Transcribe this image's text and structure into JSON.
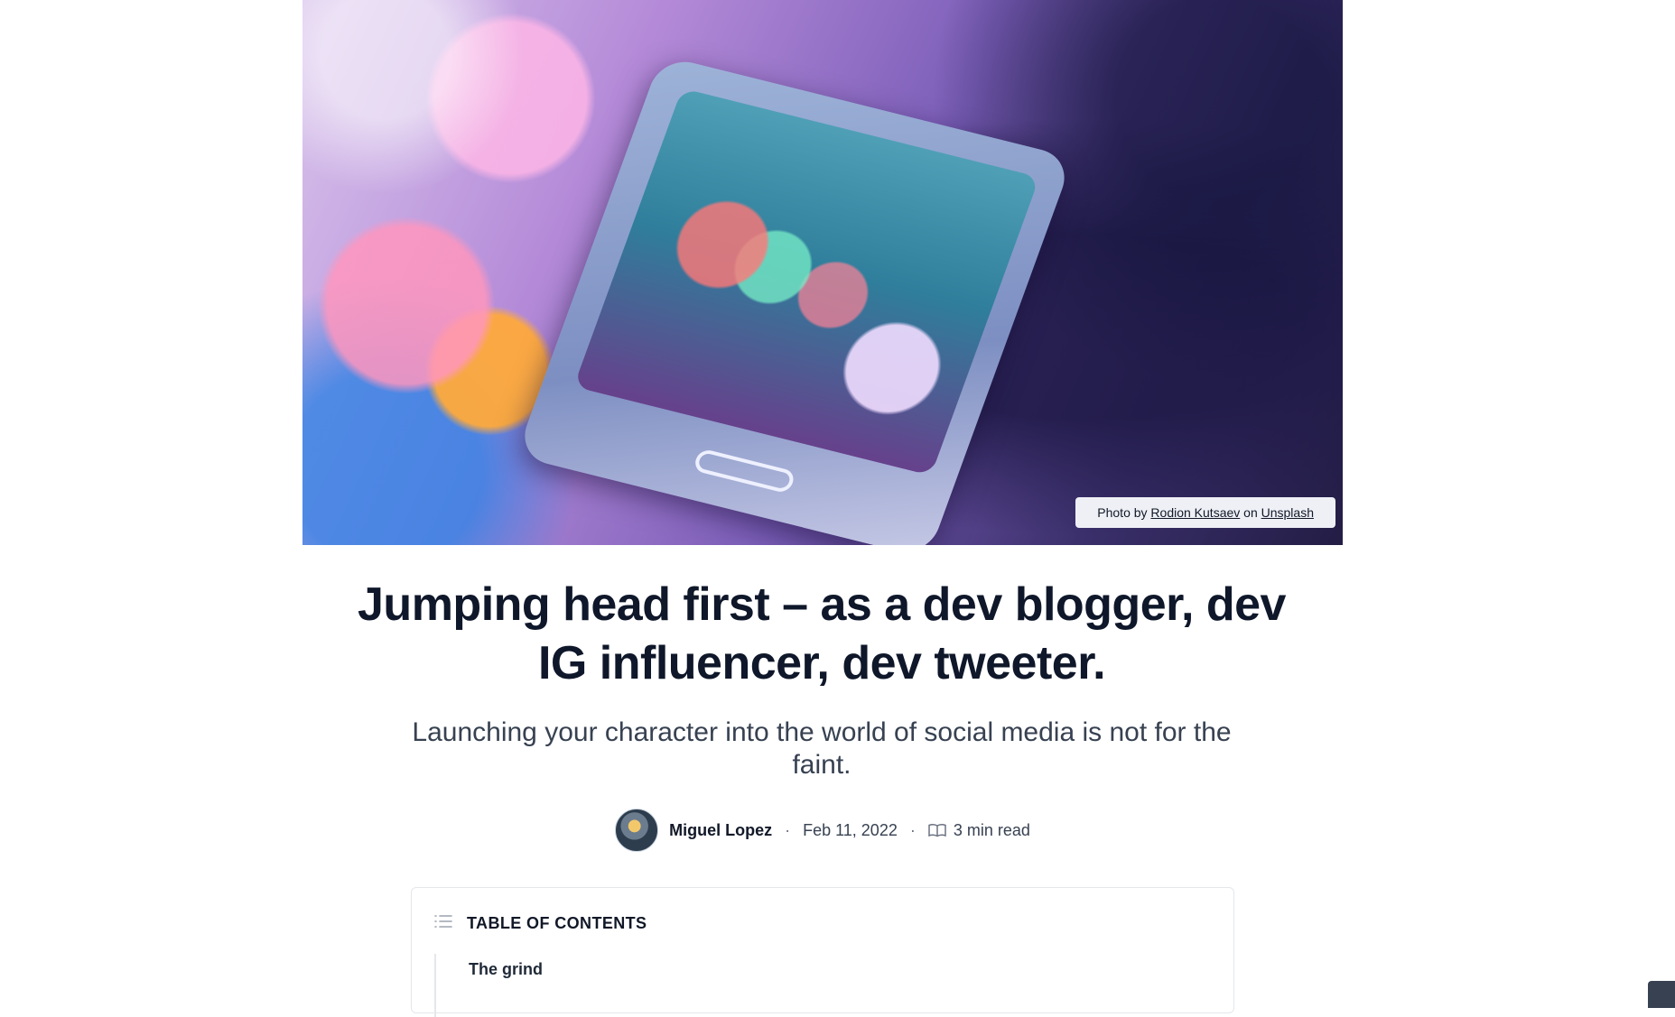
{
  "hero": {
    "caption_prefix": "Photo by",
    "caption_author": "Rodion Kutsaev",
    "caption_middle": "on",
    "caption_source": "Unsplash"
  },
  "article": {
    "title": "Jumping head first – as a dev blogger, dev IG influencer, dev tweeter.",
    "subtitle": "Launching your character into the world of social media is not for the faint.",
    "author": "Miguel Lopez",
    "date": "Feb 11, 2022",
    "read_time": "3 min read",
    "separator": "·"
  },
  "toc": {
    "title": "TABLE OF CONTENTS",
    "items": [
      "The grind"
    ]
  },
  "icons": {
    "toc": "list-icon",
    "read_time": "book-open-icon"
  },
  "colors": {
    "heading": "#0f172a",
    "text": "#374151",
    "border": "#e5e7eb",
    "caption_bg": "#eef0f6"
  }
}
